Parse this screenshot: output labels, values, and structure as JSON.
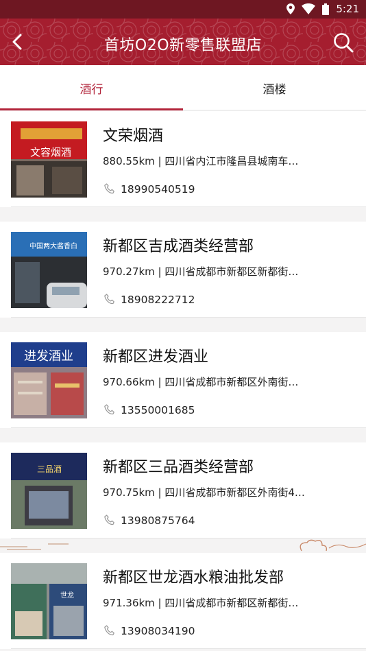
{
  "status_bar": {
    "time": "5:21",
    "icons": [
      "location-icon",
      "wifi-icon",
      "battery-icon"
    ]
  },
  "header": {
    "title": "首坊O2O新零售联盟店",
    "back_icon": "back-arrow-icon",
    "search_icon": "search-icon"
  },
  "tabs": [
    {
      "label": "酒行",
      "active": true
    },
    {
      "label": "酒楼",
      "active": false
    }
  ],
  "stores": [
    {
      "name": "文荣烟酒",
      "address": "880.55km | 四川省内江市隆昌县城南车…",
      "phone": "18990540519",
      "sign_text": "文容烟酒"
    },
    {
      "name": "新都区吉成酒类经营部",
      "address": "970.27km | 四川省成都市新都区新都街…",
      "phone": "18908222712",
      "sign_text": "中国两大酱香白"
    },
    {
      "name": "新都区进发酒业",
      "address": "970.66km | 四川省成都市新都区外南街…",
      "phone": "13550001685",
      "sign_text": "进发酒业"
    },
    {
      "name": "新都区三品酒类经营部",
      "address": "970.75km | 四川省成都市新都区外南街4…",
      "phone": "13980875764",
      "sign_text": "三品酒"
    },
    {
      "name": "新都区世龙酒水粮油批发部",
      "address": "971.36km | 四川省成都市新都区新都街…",
      "phone": "13908034190",
      "sign_text": "世龙"
    }
  ],
  "colors": {
    "header": "#a51e2f",
    "status_bar": "#6e1722",
    "accent": "#b2243a"
  }
}
